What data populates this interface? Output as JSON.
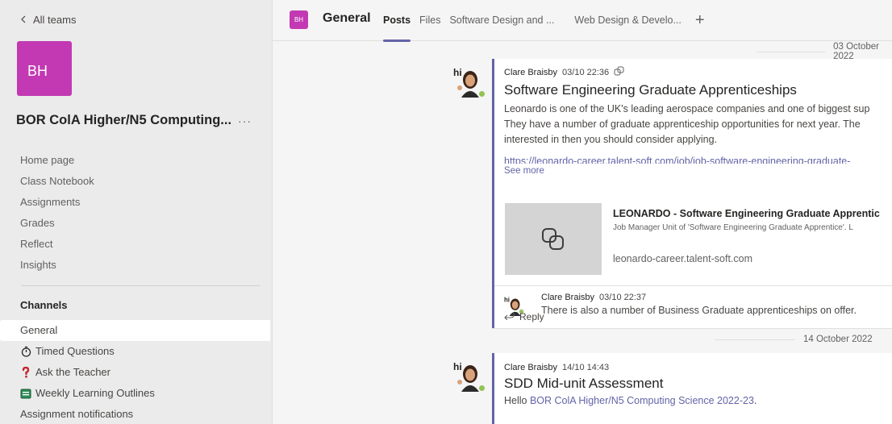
{
  "sidebar": {
    "back_label": "All teams",
    "avatar_initials": "BH",
    "team_name": "BOR ColA Higher/N5 Computing...",
    "more_label": "···",
    "nav": [
      "Home page",
      "Class Notebook",
      "Assignments",
      "Grades",
      "Reflect",
      "Insights"
    ],
    "channels_label": "Channels",
    "channels": [
      {
        "label": "General",
        "icon": ""
      },
      {
        "label": "Timed Questions",
        "icon": "stopwatch-icon"
      },
      {
        "label": "Ask the Teacher",
        "icon": "question-mark-icon"
      },
      {
        "label": "Weekly Learning Outlines",
        "icon": "green-book-icon"
      },
      {
        "label": "Assignment notifications",
        "icon": ""
      }
    ]
  },
  "header": {
    "avatar_initials": "BH",
    "title": "General",
    "tabs": [
      "Posts",
      "Files",
      "Software Design and ...",
      "Web Design & Develo..."
    ],
    "add_label": "+"
  },
  "feed": {
    "date1": "03 October 2022",
    "post1": {
      "author": "Clare Braisby",
      "time": "03/10 22:36",
      "title": "Software Engineering Graduate Apprenticeships",
      "body_lines": [
        "Leonardo is one of the UK's leading aerospace companies and one of biggest sup",
        "They have a number of graduate apprenticeship opportunities for next year. The",
        "interested in then you should consider applying."
      ],
      "link": "https://leonardo-career.talent-soft.com/job/job-software-engineering-graduate-",
      "see_more": "See more",
      "preview": {
        "title": "LEONARDO - Software Engineering Graduate Apprentic",
        "subtitle": "Job Manager Unit of 'Software Engineering Graduate Apprentice'. L",
        "domain": "leonardo-career.talent-soft.com"
      }
    },
    "reply1": {
      "author": "Clare Braisby",
      "time": "03/10 22:37",
      "text": "There is also a number of Business Graduate apprenticeships on offer."
    },
    "reply_label": "Reply",
    "date2": "14 October 2022",
    "post2": {
      "author": "Clare Braisby",
      "time": "14/10 14:43",
      "title": "SDD Mid-unit Assessment",
      "body_prefix": "Hello ",
      "mention": "BOR ColA Higher/N5 Computing Science 2022-23",
      "body_suffix": "."
    },
    "bitmoji_text": "hi"
  },
  "colors": {
    "accent": "#6264a7",
    "avatar": "#c239b3",
    "presence": "#92c353"
  }
}
